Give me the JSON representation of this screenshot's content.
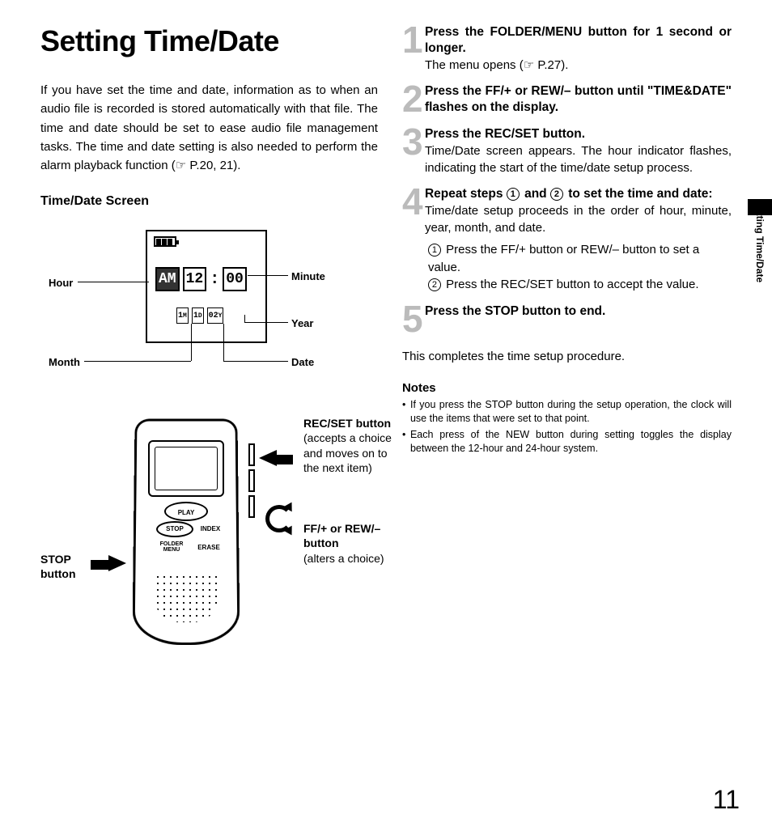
{
  "title": "Setting Time/Date",
  "intro": "If you have set the time and date, information as to when an audio file is recorded is stored automatically with that file. The time and date should be set to ease audio file management tasks. The time and date setting is also needed to perform the alarm playback function (☞ P.20, 21).",
  "screen_heading": "Time/Date Screen",
  "lcd": {
    "ampm": "AM",
    "hour": "12",
    "minute": "00",
    "month": "1",
    "month_suffix": "M",
    "date": "1",
    "date_suffix": "D",
    "year": "02",
    "year_suffix": "Y"
  },
  "lcd_labels": {
    "hour": "Hour",
    "minute": "Minute",
    "year": "Year",
    "month": "Month",
    "date": "Date"
  },
  "device_buttons": {
    "play": "PLAY",
    "stop": "STOP",
    "index": "INDEX",
    "folder_menu": "FOLDER\nMENU",
    "erase": "ERASE"
  },
  "callouts": {
    "stop": "STOP button",
    "recset_title": "REC/SET button",
    "recset_desc": "(accepts a choice and moves on to the next item)",
    "ffrew_title": "FF/+ or REW/– button",
    "ffrew_desc": "(alters a choice)"
  },
  "steps": {
    "s1_bold": "Press the FOLDER/MENU button for 1 second or longer.",
    "s1_reg": "The menu opens (☞ P.27).",
    "s2_bold": "Press the FF/+ or REW/– button until \"TIME&DATE\" flashes on the display.",
    "s3_bold": "Press the REC/SET button.",
    "s3_reg": "Time/Date screen appears. The hour indicator flashes, indicating the start of the time/date setup process.",
    "s4_bold_a": "Repeat steps ",
    "s4_bold_b": " and ",
    "s4_bold_c": " to set the time and date:",
    "s4_reg": "Time/date setup proceeds in the order of hour, minute, year, month, and date.",
    "s4_li1": "Press the FF/+ button or REW/– button to set a value.",
    "s4_li2": "Press the REC/SET button to accept the value.",
    "s5_bold": "Press the STOP button to end."
  },
  "conclude": "This completes the time setup procedure.",
  "notes_heading": "Notes",
  "notes": {
    "n1": "If you press the STOP button during the setup operation, the clock will use the items that were set to that point.",
    "n2": "Each press of the NEW button during setting toggles the display between the 12-hour and 24-hour system."
  },
  "side_tab": "Setting Time/Date",
  "page_number": "11"
}
